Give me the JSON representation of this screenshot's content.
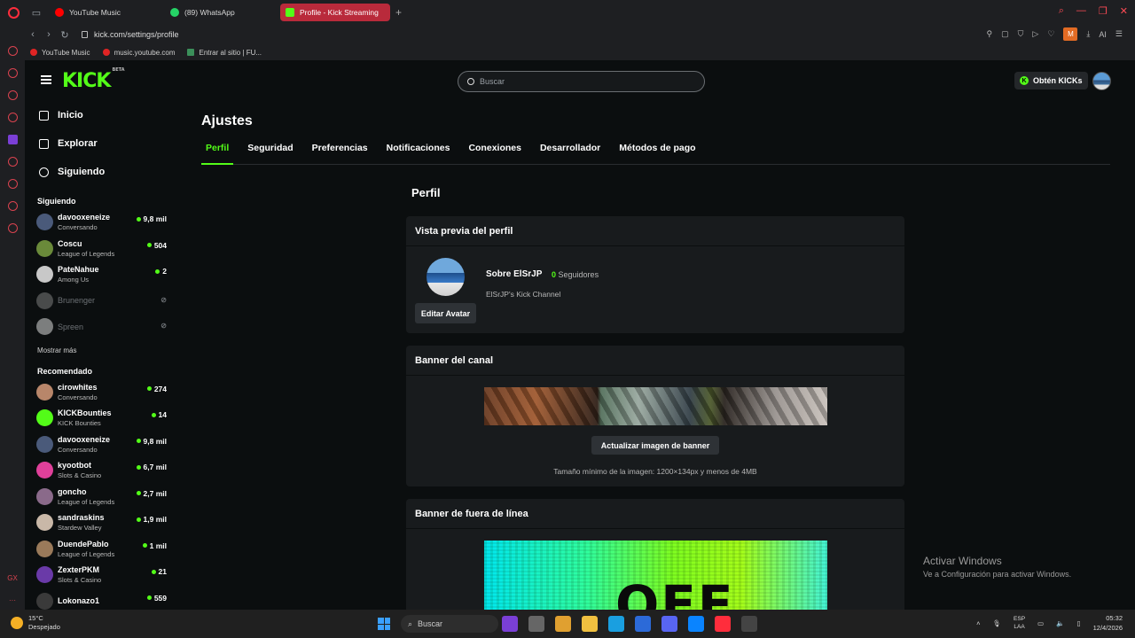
{
  "browser": {
    "tabs": [
      {
        "title": "YouTube Music",
        "color": "#ff0000",
        "active": false
      },
      {
        "title": "(89) WhatsApp",
        "color": "#25d366",
        "active": false
      },
      {
        "title": "Profile - Kick Streaming",
        "color": "#53fc18",
        "active": true
      }
    ],
    "url": "kick.com/settings/profile",
    "extension_label": "M",
    "ai_label": "AI",
    "bookmarks": [
      "YouTube Music",
      "music.youtube.com",
      "Entrar al sitio | FU..."
    ]
  },
  "kick": {
    "logo": "KICK",
    "logo_badge": "BETA",
    "search_placeholder": "Buscar",
    "kicks_button": "Obtén KICKs",
    "nav": [
      {
        "label": "Inicio",
        "icon": "home-icon"
      },
      {
        "label": "Explorar",
        "icon": "compass-icon"
      },
      {
        "label": "Siguiendo",
        "icon": "heart-icon"
      }
    ],
    "following_heading": "Siguiendo",
    "following": [
      {
        "name": "davooxeneize",
        "category": "Conversando",
        "viewers": "9,8 mil",
        "live": true,
        "color": "#4a5a7a"
      },
      {
        "name": "Coscu",
        "category": "League of Legends",
        "viewers": "504",
        "live": true,
        "color": "#6a8a3a"
      },
      {
        "name": "PateNahue",
        "category": "Among Us",
        "viewers": "2",
        "live": true,
        "color": "#c8c8c8"
      },
      {
        "name": "Brunenger",
        "category": "",
        "viewers": "",
        "live": false,
        "color": "#888888"
      },
      {
        "name": "Spreen",
        "category": "",
        "viewers": "",
        "live": false,
        "color": "#eeeeee"
      }
    ],
    "show_more": "Mostrar más",
    "recommended_heading": "Recomendado",
    "recommended": [
      {
        "name": "cirowhites",
        "category": "Conversando",
        "viewers": "274",
        "color": "#b8866a"
      },
      {
        "name": "KICKBounties",
        "category": "KICK Bounties",
        "viewers": "14",
        "color": "#53fc18"
      },
      {
        "name": "davooxeneize",
        "category": "Conversando",
        "viewers": "9,8 mil",
        "color": "#4a5a7a"
      },
      {
        "name": "kyootbot",
        "category": "Slots & Casino",
        "viewers": "6,7 mil",
        "color": "#e0409a"
      },
      {
        "name": "goncho",
        "category": "League of Legends",
        "viewers": "2,7 mil",
        "color": "#8a6a8a"
      },
      {
        "name": "sandraskins",
        "category": "Stardew Valley",
        "viewers": "1,9 mil",
        "color": "#c9b8a8"
      },
      {
        "name": "DuendePablo",
        "category": "League of Legends",
        "viewers": "1 mil",
        "color": "#9a7a5a"
      },
      {
        "name": "ZexterPKM",
        "category": "Slots & Casino",
        "viewers": "21",
        "color": "#6a3aa8"
      },
      {
        "name": "Lokonazo1",
        "category": "",
        "viewers": "559",
        "color": "#3a3a3a"
      }
    ],
    "settings_title": "Ajustes",
    "settings_tabs": [
      "Perfil",
      "Seguridad",
      "Preferencias",
      "Notificaciones",
      "Conexiones",
      "Desarrollador",
      "Métodos de pago"
    ],
    "profile_heading": "Perfil",
    "preview_card": {
      "title": "Vista previa del perfil",
      "about": "Sobre ElSrJP",
      "followers_count": "0",
      "followers_label": "Seguidores",
      "description": "ElSrJP's Kick Channel",
      "edit_avatar": "Editar Avatar"
    },
    "banner_card": {
      "title": "Banner del canal",
      "update_button": "Actualizar imagen de banner",
      "note": "Tamaño mínimo de la imagen: 1200×134px y menos de 4MB"
    },
    "offline_card": {
      "title": "Banner de fuera de línea",
      "image_text": "OFF"
    }
  },
  "watermark": {
    "title": "Activar Windows",
    "subtitle": "Ve a Configuración para activar Windows."
  },
  "taskbar": {
    "weather_temp": "15°C",
    "weather_desc": "Despejado",
    "search": "Buscar",
    "lang_top": "ESP",
    "lang_bottom": "LAA",
    "time": "05:32",
    "date": "12/4/2026",
    "app_colors": [
      "#7a3fd6",
      "#666666",
      "#e0a030",
      "#f0c040",
      "#1a9fe0",
      "#2c6ad8",
      "#5865f2",
      "#0a84ff",
      "#ff2d3c",
      "#444444"
    ]
  }
}
